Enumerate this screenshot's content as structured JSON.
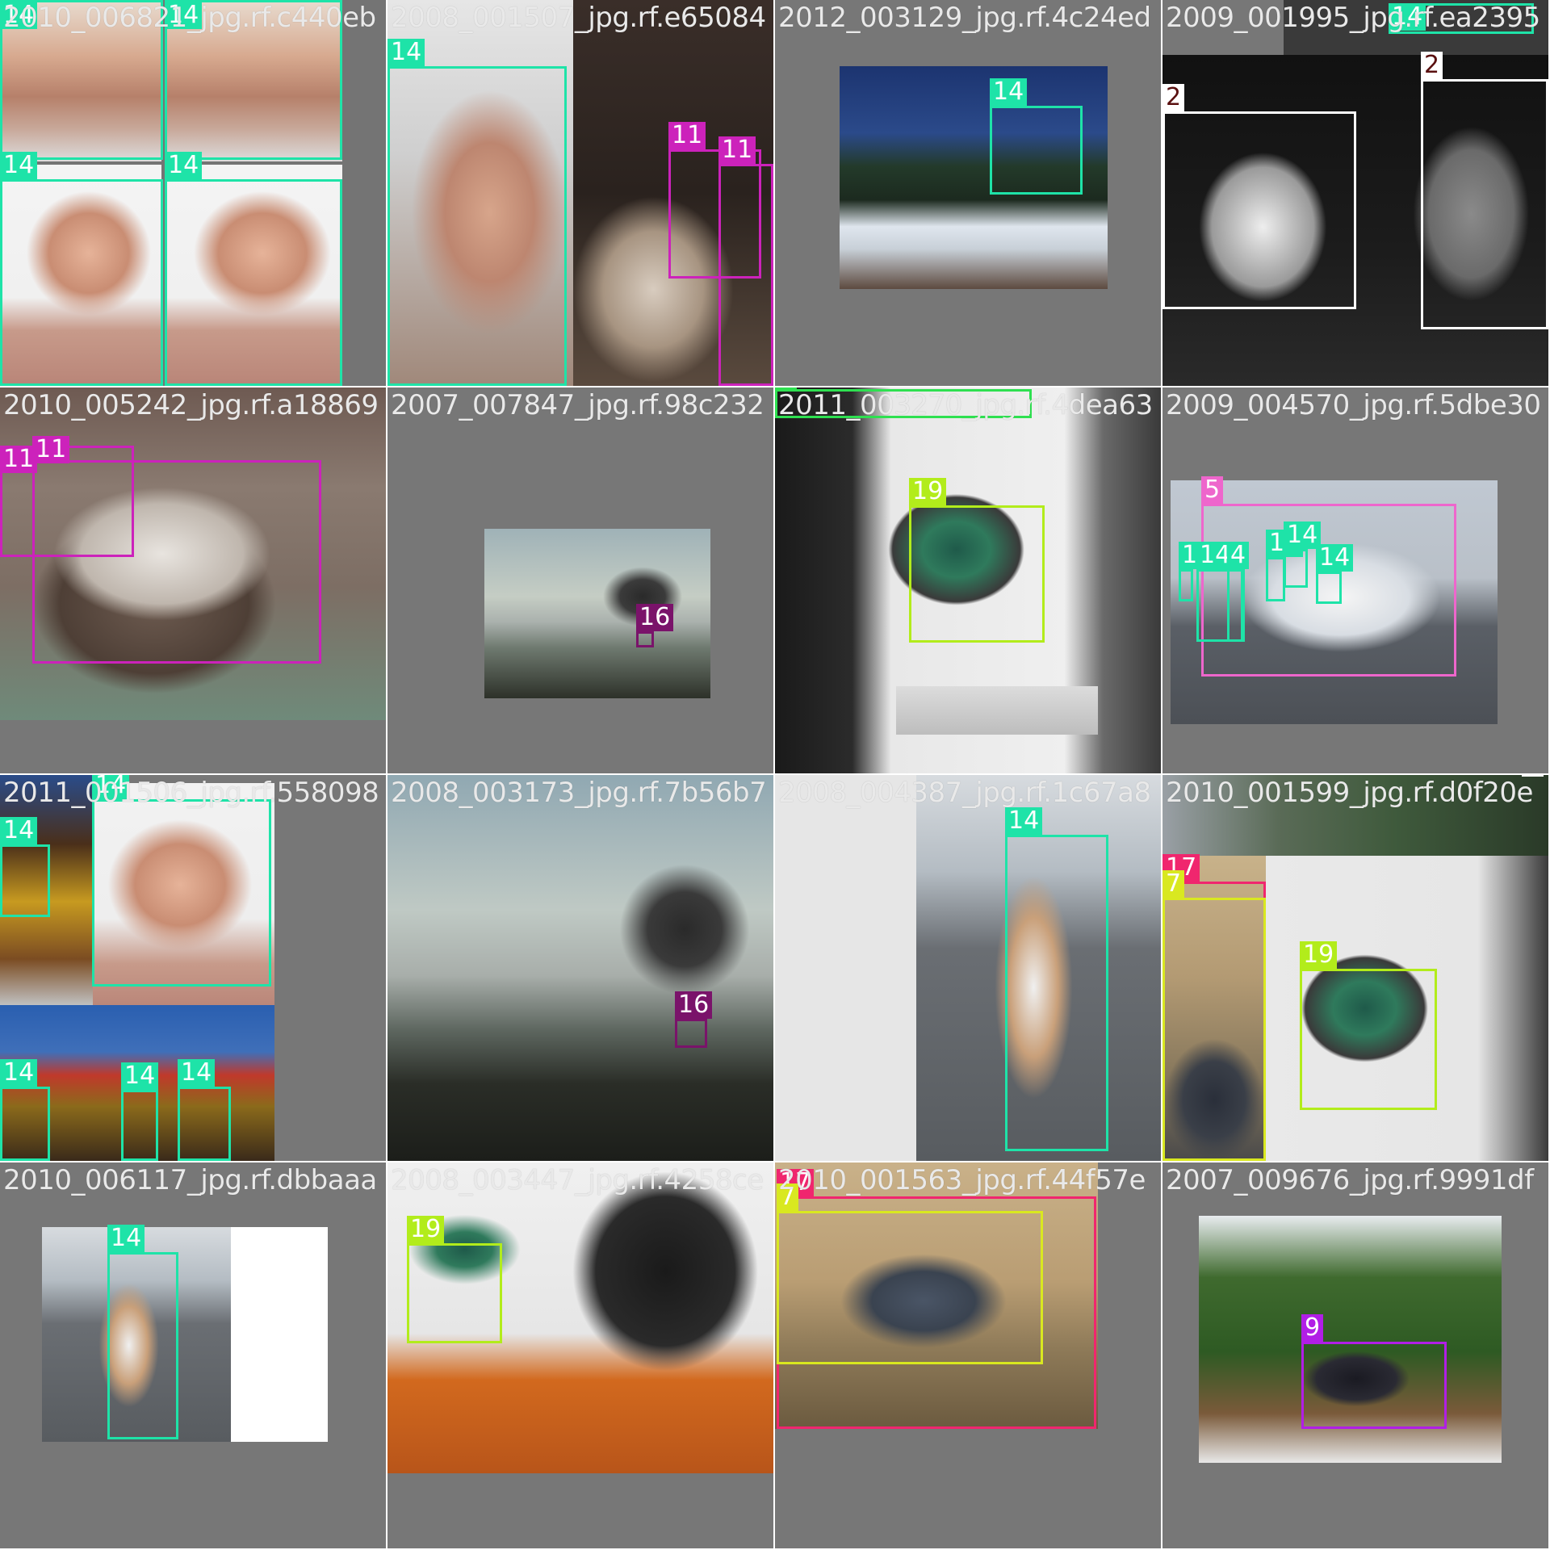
{
  "palette": {
    "c14": "#1ee3a8",
    "c11": "#cc22bb",
    "c2": "#ffffff",
    "c16": "#7a136a",
    "c19": "#b2ec1b",
    "c8": "#2ee050",
    "c5": "#ee66cc",
    "c17": "#f0266e",
    "c7": "#d9e820",
    "c9": "#b11ee6"
  },
  "tiles": [
    {
      "filename": "2010_006821_jpg.rf.c440eb",
      "boxes": [
        "14",
        "14",
        "14",
        "14"
      ]
    },
    {
      "filename": "2008_001507_jpg.rf.e65084",
      "boxes": [
        "14",
        "11",
        "11"
      ]
    },
    {
      "filename": "2012_003129_jpg.rf.4c24ed",
      "boxes": [
        "14"
      ]
    },
    {
      "filename": "2009_001995_jpg.rf.ea2395",
      "boxes": [
        "14",
        "2",
        "2"
      ]
    },
    {
      "filename": "2010_005242_jpg.rf.a18869",
      "boxes": [
        "11",
        "11"
      ]
    },
    {
      "filename": "2007_007847_jpg.rf.98c232",
      "boxes": [
        "16"
      ]
    },
    {
      "filename": "2011_003270_jpg.rf.4dea63",
      "boxes": [
        "8",
        "19"
      ]
    },
    {
      "filename": "2009_004570_jpg.rf.5dbe30",
      "boxes": [
        "5",
        "14",
        "14",
        "4",
        "14",
        "14",
        "14"
      ]
    },
    {
      "filename": "2011_001506_jpg.rf.558098",
      "boxes": [
        "14",
        "14",
        "14",
        "14",
        "14",
        "14"
      ]
    },
    {
      "filename": "2008_003173_jpg.rf.7b56b7",
      "boxes": [
        "16"
      ]
    },
    {
      "filename": "2008_004387_jpg.rf.1c67a8",
      "boxes": [
        "14"
      ]
    },
    {
      "filename": "2010_001599_jpg.rf.d0f20e",
      "boxes": [
        "2",
        "17",
        "7",
        "19"
      ]
    },
    {
      "filename": "2010_006117_jpg.rf.dbbaaa",
      "boxes": [
        "14"
      ]
    },
    {
      "filename": "2008_003447_jpg.rf.4258ce",
      "boxes": [
        "19"
      ]
    },
    {
      "filename": "2010_001563_jpg.rf.44f57e",
      "boxes": [
        "17",
        "7"
      ]
    },
    {
      "filename": "2007_009676_jpg.rf.9991df",
      "boxes": [
        "9"
      ]
    }
  ]
}
